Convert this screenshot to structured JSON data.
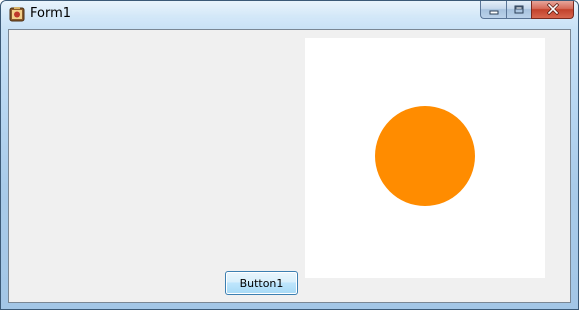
{
  "window": {
    "title": "Form1"
  },
  "icons": {
    "app": "app-icon",
    "minimize": "minimize-icon",
    "maximize": "maximize-icon",
    "close": "close-icon"
  },
  "main": {
    "button1_label": "Button1",
    "circle_color": "#ff8c00",
    "panel_color": "#ffffff"
  }
}
